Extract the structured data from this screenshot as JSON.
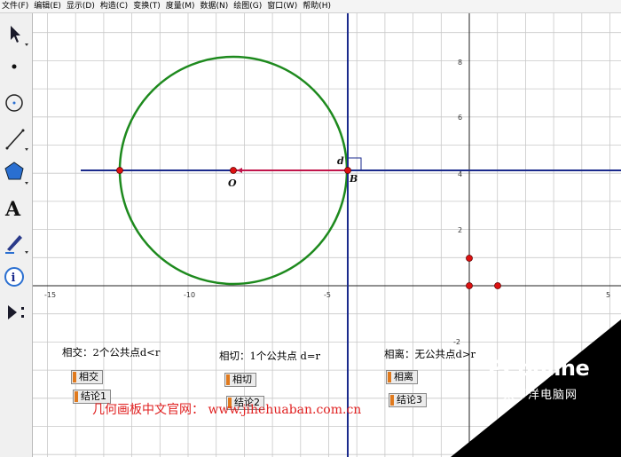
{
  "menu": [
    {
      "label": "文件(F)"
    },
    {
      "label": "编辑(E)"
    },
    {
      "label": "显示(D)"
    },
    {
      "label": "构造(C)"
    },
    {
      "label": "变换(T)"
    },
    {
      "label": "度量(M)"
    },
    {
      "label": "数据(N)"
    },
    {
      "label": "绘图(G)"
    },
    {
      "label": "窗口(W)"
    },
    {
      "label": "帮助(H)"
    }
  ],
  "tools": [
    {
      "icon": "arrow-select-icon"
    },
    {
      "icon": "point-tool-icon"
    },
    {
      "icon": "compass-tool-icon"
    },
    {
      "icon": "line-tool-icon"
    },
    {
      "icon": "polygon-tool-icon"
    },
    {
      "icon": "text-tool-icon"
    },
    {
      "icon": "marker-tool-icon"
    },
    {
      "icon": "information-tool-icon"
    },
    {
      "icon": "custom-tool-icon"
    }
  ],
  "graph": {
    "x_ticks": [
      "-15",
      "-10",
      "-5",
      "5"
    ],
    "y_ticks": [
      "8",
      "6",
      "4",
      "2",
      "-2"
    ],
    "colors": {
      "circle": "#1e8a1e",
      "line": "#1a2a8c",
      "segment": "#c0154a",
      "point": "#dd1111",
      "grid": "#c8c8c8",
      "axis": "#222222"
    },
    "points": {
      "O_label": "O",
      "B_label": "B",
      "d_label": "d"
    }
  },
  "panels": [
    {
      "heading": "相交：2个公共点d<r",
      "btn1": "相交",
      "btn2": "结论1"
    },
    {
      "heading": "相切：1个公共点 d=r",
      "btn1": "相切",
      "btn2": "结论2"
    },
    {
      "heading": "相离：无公共点d>r",
      "btn1": "相离",
      "btn2": "结论3"
    }
  ],
  "footer": "几何画板中文官网： www.jihehuaban.com.cn",
  "watermark": {
    "brand": "PConline",
    "sub": "太平洋电脑网",
    "color": "#000000"
  }
}
